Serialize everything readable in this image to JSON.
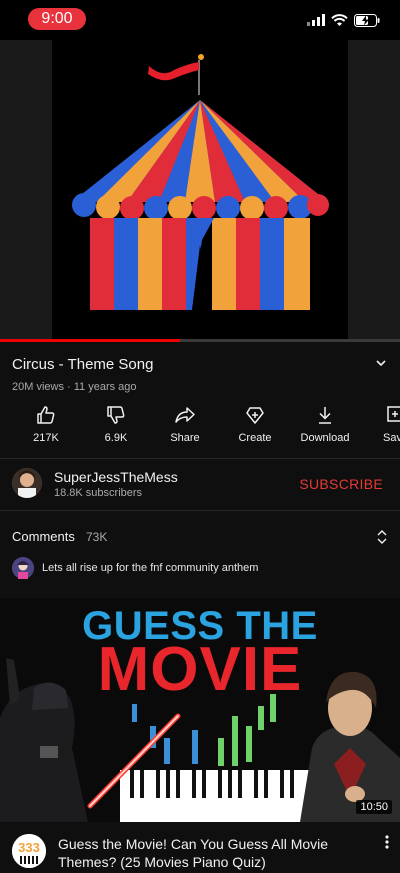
{
  "status_bar": {
    "time": "9:00"
  },
  "player": {
    "progress_percent": 45
  },
  "video": {
    "title": "Circus - Theme Song",
    "meta": "20M views · 11 years ago"
  },
  "actions": [
    {
      "label": "217K",
      "icon": "thumbs-up-icon"
    },
    {
      "label": "6.9K",
      "icon": "thumbs-down-icon"
    },
    {
      "label": "Share",
      "icon": "share-icon"
    },
    {
      "label": "Create",
      "icon": "create-icon"
    },
    {
      "label": "Download",
      "icon": "download-icon"
    },
    {
      "label": "Sav",
      "icon": "save-icon"
    }
  ],
  "channel": {
    "name": "SuperJessTheMess",
    "subscribers": "18.8K subscribers",
    "subscribe_label": "SUBSCRIBE"
  },
  "comments": {
    "title": "Comments",
    "count": "73K",
    "top_comment": "Lets all rise up for the fnf community anthem"
  },
  "recommended": {
    "thumbnail_line1": "GUESS THE",
    "thumbnail_line2": "MOVIE",
    "duration": "10:50",
    "channel_avatar_text": "333",
    "title": "Guess the Movie! Can You Guess All Movie Themes? (25 Movies Piano Quiz)"
  },
  "colors": {
    "background": "#0f0f0f",
    "subscribe": "#e53935",
    "progress": "#ee0000",
    "time_pill": "#e8323c"
  }
}
